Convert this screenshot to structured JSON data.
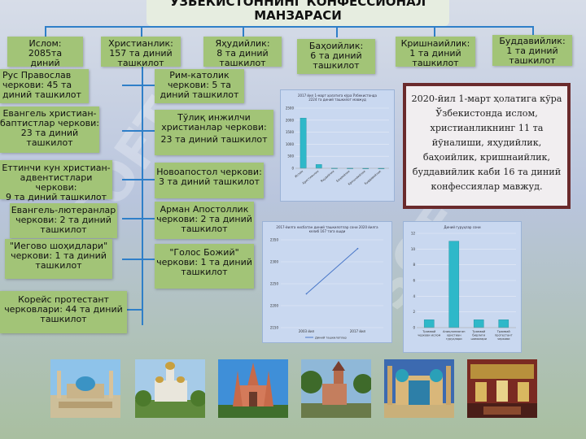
{
  "header": {
    "title_line1": "ЎЗБЕКИСТОННИНГ КОНФЕССИОНАЛ",
    "title_line2": "МАНЗАРАСИ"
  },
  "confessions": [
    {
      "name": "Ислом:",
      "count": "2085та диний ташкилот"
    },
    {
      "name": "Христианлик:",
      "count": "157 та диний ташкилот"
    },
    {
      "name": "Яҳудийлик:",
      "count": "8 та диний ташкилот"
    },
    {
      "name": "Баҳоийлик:",
      "count": "6 та диний ташкилот"
    },
    {
      "name": "Кришнаийлик:",
      "count": "1 та диний ташкилот"
    },
    {
      "name": "Буддавийлик:",
      "count": "1 та диний ташкилот"
    }
  ],
  "christian_left": [
    {
      "line1": "Рус Православ",
      "line2": "черкови: 45 та",
      "line3": "диний ташкилот",
      "line4": ""
    },
    {
      "line1": "Евангель христиан-",
      "line2": "баптистлар черкови:",
      "line3": "23 та диний",
      "line4": "ташкилот"
    },
    {
      "line1": "Еттинчи кун христиан-",
      "line2": "адвентистлари черкови:",
      "line3": "9 та диний ташкилот",
      "line4": ""
    },
    {
      "line1": "Евангель-лютеранлар",
      "line2": "черкови: 2 та диний",
      "line3": "ташкилот",
      "line4": ""
    },
    {
      "line1": "\"Иегово шоҳидлари\"",
      "line2": "черкови: 1 та диний",
      "line3": "ташкилот",
      "line4": ""
    },
    {
      "line1": "Корейс протестант",
      "line2": "черковлари: 44 та диний",
      "line3": "ташкилот",
      "line4": ""
    }
  ],
  "christian_right": [
    {
      "line1": "Рим-католик",
      "line2": "черкови: 5 та",
      "line3": "диний ташкилот"
    },
    {
      "line1": "Тўлиқ инжилчи",
      "line2": "христианлар черкови:",
      "line3": "23 та диний ташкилот"
    },
    {
      "line1": "Новоапостол черкови:",
      "line2": "3 та диний ташкилот",
      "line3": ""
    },
    {
      "line1": "Арман Апостоллик",
      "line2": "черкови: 2 та диний",
      "line3": "ташкилот"
    },
    {
      "line1": "\"Голос Божий\"",
      "line2": "черкови: 1 та диний",
      "line3": "ташкилот"
    }
  ],
  "info": {
    "text": "2020-йил 1-март ҳолатига кўра Ўзбекистонда ислом, христианликнинг 11 та йўналиши, яҳудийлик, баҳоийлик, кришнаийлик, буддавийлик каби 16 та диний конфессиялар мавжуд."
  },
  "chart_data": [
    {
      "type": "bar",
      "title": "2017 йил 1-март ҳолатига кўра Ўзбекистонда 2224 та диний ташкилот мавжуд",
      "categories": [
        "Ислом",
        "Христианлик",
        "Яҳудийлик",
        "Баҳоийлик",
        "Кришнаийлик",
        "Буддавийлик"
      ],
      "values": [
        2085,
        157,
        8,
        6,
        1,
        1
      ],
      "ylim": [
        0,
        2500
      ],
      "yticks": [
        "2500",
        "2000",
        "1500",
        "1000",
        "500",
        "0"
      ],
      "color": "#2eb8c9"
    },
    {
      "type": "line",
      "title": "2017-йилга нисбатан диний ташкилотлар сони 2020 йилга келиб 167 тага ошди",
      "categories": [
        "2003 йил",
        "2017 йил"
      ],
      "values": [
        2227,
        2330
      ],
      "ylim": [
        2150,
        2350
      ],
      "yticks": [
        "2350",
        "2300",
        "2250",
        "2200",
        "2150"
      ],
      "legend": "Диний ташкилотлар",
      "color": "#4a78c8"
    },
    {
      "type": "bar",
      "title": "Диний гуруҳлар сони",
      "categories": [
        "Трамвай черкови ислом",
        "Аниқланмаган христиан гуруҳлари",
        "Трамвай бирлиги шамолари",
        "Трамвай протестант черкови"
      ],
      "values": [
        1,
        11,
        1,
        1
      ],
      "ylim": [
        0,
        12
      ],
      "yticks": [
        "12",
        "10",
        "8",
        "6",
        "4",
        "2",
        "0"
      ],
      "color": "#2eb8c9"
    }
  ],
  "photos": [
    {
      "name": "mosque-square-photo"
    },
    {
      "name": "orthodox-cathedral-photo"
    },
    {
      "name": "catholic-church-photo"
    },
    {
      "name": "lutheran-church-photo"
    },
    {
      "name": "registan-madrasa-photo"
    },
    {
      "name": "synagogue-interior-photo"
    }
  ]
}
